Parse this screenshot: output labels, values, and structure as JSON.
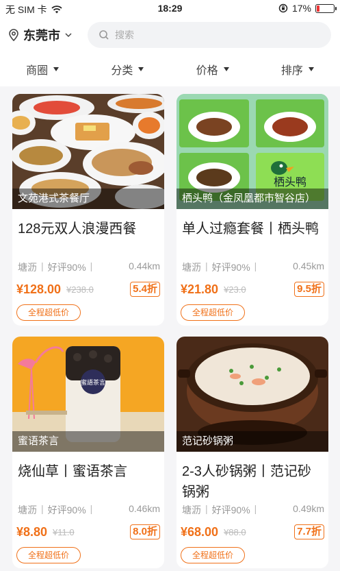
{
  "status": {
    "carrier": "无 SIM 卡",
    "time": "18:29",
    "battery": "17%",
    "battery_level": 0.17,
    "icons": [
      "wifi-icon",
      "orientation-lock-icon",
      "battery-icon"
    ]
  },
  "header": {
    "city": "东莞市",
    "search_placeholder": "搜索"
  },
  "filters": [
    "商圈",
    "分类",
    "价格",
    "排序"
  ],
  "colors": {
    "accent": "#f07018",
    "background": "#f5f5f7",
    "muted": "#999999"
  },
  "cards": [
    {
      "shop": "文苑港式茶餐厅",
      "title": "128元双人浪漫西餐",
      "area": "塘沥",
      "rating": "好评90%",
      "distance": "0.44km",
      "price": "¥128.00",
      "original": "¥238.0",
      "discount": "5.4折",
      "tag": "全程超低价"
    },
    {
      "shop": "栖头鸭（金凤凰都市智谷店）",
      "title": "单人过瘾套餐丨栖头鸭",
      "area": "塘沥",
      "rating": "好评90%",
      "distance": "0.45km",
      "price": "¥21.80",
      "original": "¥23.0",
      "discount": "9.5折",
      "tag": "全程超低价",
      "image_text": "栖头鸭"
    },
    {
      "shop": "蜜语茶言",
      "title": "烧仙草丨蜜语茶言",
      "area": "塘沥",
      "rating": "好评90%",
      "distance": "0.46km",
      "price": "¥8.80",
      "original": "¥11.0",
      "discount": "8.0折",
      "tag": "全程超低价",
      "image_text": "蜜語茶言"
    },
    {
      "shop": "范记砂锅粥",
      "title": "2-3人砂锅粥丨范记砂锅粥",
      "area": "塘沥",
      "rating": "好评90%",
      "distance": "0.49km",
      "price": "¥68.00",
      "original": "¥88.0",
      "discount": "7.7折",
      "tag": "全程超低价"
    }
  ]
}
